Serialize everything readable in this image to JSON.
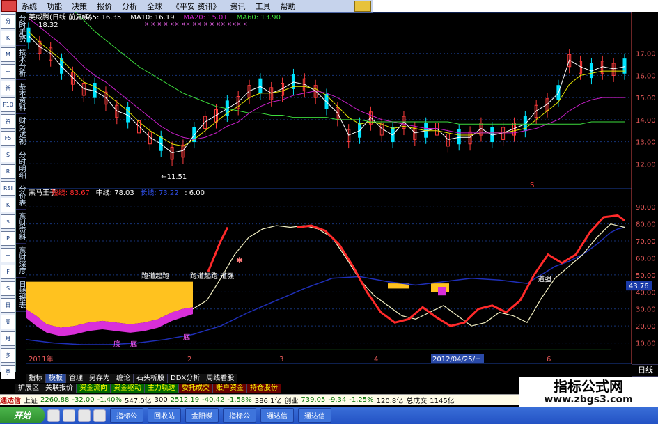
{
  "menu": {
    "items": [
      "系统",
      "功能",
      "决策",
      "报价",
      "分析",
      "全球",
      "《平安 资讯》",
      "资讯",
      "工具",
      "帮助"
    ]
  },
  "left_toolbar": {
    "icons": [
      "分",
      "K",
      "M",
      "~",
      "新",
      "F10",
      "资",
      "F5",
      "S",
      "R",
      "RSI",
      "K",
      "$",
      "P",
      "+",
      "F",
      "S",
      "日",
      "周",
      "月",
      "多",
      "季"
    ],
    "labels_bottom": [
      "日",
      "周",
      "月",
      "多",
      "季"
    ]
  },
  "vertical_tabs": [
    "分时走势",
    "技术分析",
    "基本资料",
    "财务透视",
    "分时明细",
    "分价表",
    "东财资料",
    "东财深度",
    "日线报表"
  ],
  "chart_header": {
    "name": "英威腾(日线 前复权)",
    "ma5": "MA5: 16.35",
    "ma10": "MA10: 16.19",
    "ma20": "MA20: 15.01",
    "ma60": "MA60: 13.90",
    "markers": "× ×   ×  ×     ×× ×× ×× ×   × ×× ×××  ×"
  },
  "indicator_header": {
    "name": "黑马王子",
    "short": "短线: 83.67",
    "mid": "中线: 78.03",
    "long": "长线: 73.22",
    "v4": ": 6.00"
  },
  "colors": {
    "up": "#ff3c3c",
    "down": "#00e5ff",
    "ma5": "#ffffff",
    "ma10": "#e6e600",
    "ma20": "#c71fc7",
    "ma60": "#3ddc3d",
    "short": "#ff2a2a",
    "mid": "#f5f2c4",
    "long": "#1f2fb8",
    "fill_gold": "#ffc21f",
    "fill_magenta": "#d92fd9",
    "grid": "#17357a",
    "axis": "#e85a5a"
  },
  "chart_data": [
    {
      "type": "line",
      "title": "英威腾(日线 前复权)",
      "x": [
        0,
        4,
        8,
        12,
        16,
        20,
        24,
        28,
        32,
        36,
        40,
        44,
        48,
        52,
        56,
        60,
        64,
        68,
        72,
        76,
        80,
        84,
        88,
        92,
        96,
        100,
        104,
        108,
        112,
        116,
        120,
        124,
        128,
        132,
        136,
        140,
        144,
        148,
        152,
        156,
        160,
        164,
        168,
        172,
        176,
        180,
        184,
        188,
        192,
        196,
        200,
        204,
        208,
        212,
        216
      ],
      "series": [
        {
          "name": "MA5",
          "values": [
            17.8,
            17.3,
            17.0,
            16.4,
            15.9,
            15.4,
            15.3,
            15.0,
            14.4,
            14.2,
            13.7,
            13.2,
            12.9,
            12.5,
            12.6,
            13.3,
            13.9,
            14.2,
            14.5,
            14.8,
            15.3,
            15.5,
            15.2,
            15.4,
            15.7,
            15.6,
            15.3,
            14.8,
            14.3,
            13.3,
            13.5,
            14.1,
            13.6,
            13.3,
            13.9,
            13.4,
            13.5,
            13.6,
            13.1,
            13.2,
            13.2,
            13.6,
            13.3,
            13.4,
            13.6,
            13.8,
            14.4,
            14.7,
            15.2,
            16.7,
            16.4,
            16.2,
            16.4,
            16.3,
            16.4
          ]
        },
        {
          "name": "MA10",
          "values": [
            18.0,
            17.5,
            17.1,
            16.7,
            16.2,
            15.7,
            15.5,
            15.2,
            14.8,
            14.4,
            13.9,
            13.5,
            13.2,
            12.9,
            12.8,
            13.1,
            13.5,
            13.9,
            14.3,
            14.6,
            15.0,
            15.2,
            15.2,
            15.3,
            15.5,
            15.5,
            15.4,
            15.1,
            14.6,
            14.1,
            13.8,
            13.9,
            13.8,
            13.6,
            13.7,
            13.6,
            13.5,
            13.5,
            13.4,
            13.3,
            13.3,
            13.4,
            13.4,
            13.4,
            13.5,
            13.6,
            14.0,
            14.4,
            14.8,
            15.6,
            16.0,
            16.1,
            16.2,
            16.2,
            16.2
          ]
        },
        {
          "name": "MA20",
          "values": [
            18.6,
            18.2,
            17.8,
            17.4,
            16.9,
            16.4,
            16.0,
            15.7,
            15.3,
            14.9,
            14.5,
            14.1,
            13.7,
            13.4,
            13.2,
            13.1,
            13.2,
            13.4,
            13.7,
            13.9,
            14.3,
            14.6,
            14.8,
            14.9,
            15.1,
            15.2,
            15.3,
            15.2,
            15.0,
            14.7,
            14.4,
            14.2,
            14.0,
            13.9,
            13.8,
            13.7,
            13.6,
            13.6,
            13.5,
            13.4,
            13.4,
            13.4,
            13.4,
            13.4,
            13.4,
            13.5,
            13.6,
            13.8,
            14.0,
            14.4,
            14.7,
            14.9,
            15.0,
            15.0,
            15.0
          ]
        },
        {
          "name": "MA60",
          "values": [
            21.0,
            20.5,
            20.0,
            19.5,
            19.0,
            18.5,
            18.0,
            17.6,
            17.2,
            16.8,
            16.4,
            16.1,
            15.8,
            15.5,
            15.2,
            15.0,
            14.8,
            14.6,
            14.5,
            14.4,
            14.3,
            14.3,
            14.2,
            14.2,
            14.1,
            14.1,
            14.1,
            14.1,
            14.0,
            14.0,
            14.0,
            13.9,
            13.9,
            13.9,
            13.9,
            13.9,
            13.9,
            13.9,
            13.9,
            13.8,
            13.8,
            13.8,
            13.8,
            13.8,
            13.8,
            13.8,
            13.8,
            13.8,
            13.8,
            13.8,
            13.8,
            13.9,
            13.9,
            13.9,
            13.9
          ]
        }
      ],
      "annotations": [
        "18.32",
        "11.51",
        "S"
      ],
      "ylim": [
        11,
        18
      ],
      "ytick_labels": [
        "17.00",
        "16.00",
        "15.00",
        "14.00",
        "13.00",
        "12.00"
      ]
    },
    {
      "type": "line",
      "title": "黑马王子",
      "x": [
        0,
        5,
        10,
        15,
        20,
        25,
        30,
        35,
        40,
        45,
        50,
        55,
        60,
        65,
        70,
        75,
        80,
        85,
        90,
        95,
        100,
        105,
        110,
        115,
        120,
        125,
        130,
        135,
        140,
        145,
        150,
        155,
        160,
        165,
        170,
        175,
        180,
        185,
        190,
        195,
        200,
        205,
        210,
        215
      ],
      "series": [
        {
          "name": "短线",
          "values": [
            null,
            null,
            null,
            null,
            null,
            null,
            null,
            null,
            null,
            null,
            null,
            null,
            null,
            null,
            null,
            null,
            null,
            null,
            null,
            null,
            null,
            null,
            null,
            null,
            null,
            null,
            null,
            null,
            null,
            null,
            null,
            null,
            null,
            null,
            null,
            null,
            null,
            null,
            null,
            null,
            null,
            null,
            null,
            null
          ]
        },
        {
          "name": "中线",
          "values": [
            null,
            null,
            null,
            null,
            null,
            null,
            null,
            null,
            null,
            null,
            null,
            null,
            null,
            null,
            null,
            null,
            null,
            null,
            null,
            null,
            null,
            null,
            null,
            null,
            null,
            null,
            null,
            null,
            null,
            null,
            null,
            null,
            null,
            null,
            null,
            null,
            null,
            null,
            null,
            null,
            null,
            null,
            null,
            null
          ]
        },
        {
          "name": "长线",
          "values": [
            null,
            null,
            null,
            null,
            null,
            null,
            null,
            null,
            null,
            null,
            null,
            null,
            null,
            null,
            null,
            null,
            null,
            null,
            null,
            null,
            null,
            null,
            null,
            null,
            null,
            null,
            null,
            null,
            null,
            null,
            null,
            null,
            null,
            null,
            null,
            null,
            null,
            null,
            null,
            null,
            null,
            null,
            null,
            null
          ]
        }
      ],
      "ylim": [
        0,
        95
      ],
      "ytick_labels": [
        "90.00",
        "80.00",
        "70.00",
        "60.00",
        "50.00",
        "40.00",
        "30.00",
        "20.00",
        "10.00"
      ],
      "current_value": "43.76",
      "annotations": [
        "跑道起跑",
        "跑道起跑",
        "道强",
        "跑道起跑 道强",
        "底",
        "底",
        "底"
      ],
      "xlabels": [
        "2011年",
        "2",
        "3",
        "4",
        "2012/04/25/三",
        "6"
      ]
    }
  ],
  "bottom_tabs": [
    "指标",
    "模板",
    "管理",
    "另存为",
    "缠论",
    "石头析股",
    "DDX分析",
    "周线看股"
  ],
  "bottom_tabs2": [
    "扩展区",
    "关联报价",
    "资金流向",
    "资金驱动",
    "主力轨迹",
    "委托成交",
    "账户资金",
    "持仓股份"
  ],
  "day_button": "日线",
  "statusbar": {
    "app": "通达信",
    "sh_label": "上证",
    "sh_val": "2260.88",
    "sh_chg": "-32.00",
    "sh_pct": "-1.40%",
    "sh_amt": "547.0亿",
    "s2": "300",
    "s2_val": "2512.19",
    "s2_chg": "-40.42",
    "s2_pct": "-1.58%",
    "s2_amt": "386.1亿",
    "cy_label": "创业",
    "cy_val": "739.05",
    "cy_chg": "-9.34",
    "cy_pct": "-1.25%",
    "cy_amt": "120.8亿",
    "total_label": "总成交",
    "total": "1145亿"
  },
  "taskbar": {
    "start": "开始",
    "apps": [
      "指标公",
      "回收站",
      "金阳蝶",
      "指标公",
      "通达信",
      "通达信"
    ]
  },
  "watermark": {
    "line1": "指标公式网",
    "line2": "www.zbgs3.com"
  }
}
